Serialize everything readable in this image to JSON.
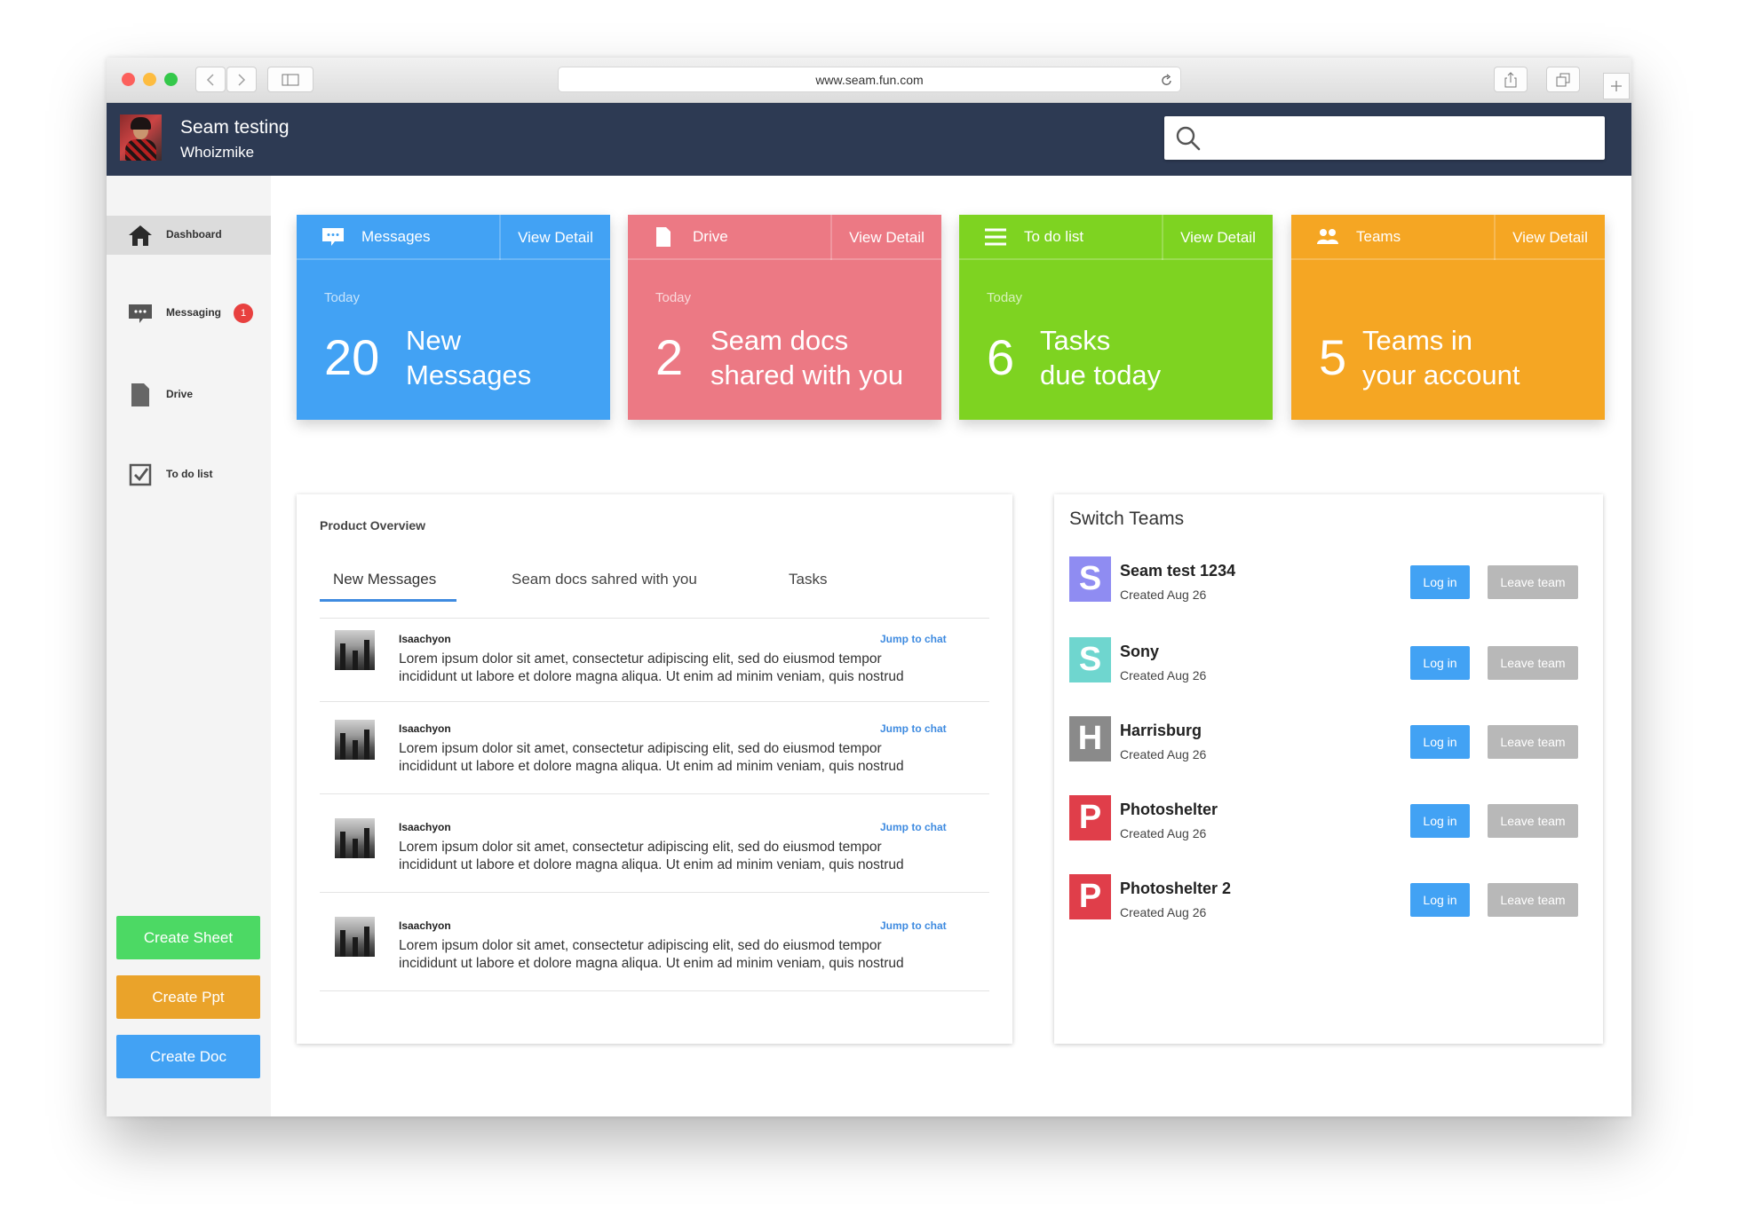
{
  "browser": {
    "url": "www.seam.fun.com"
  },
  "user": {
    "name": "Seam testing",
    "handle": "Whoizmike"
  },
  "search": {
    "placeholder": ""
  },
  "sidebar": {
    "items": [
      {
        "label": "Dashboard",
        "icon": "home-icon"
      },
      {
        "label": "Messaging",
        "icon": "chat-icon",
        "badge": "1"
      },
      {
        "label": "Drive",
        "icon": "document-icon"
      },
      {
        "label": "To do list",
        "icon": "checkbox-icon"
      }
    ],
    "actions": {
      "create_sheet": "Create Sheet",
      "create_ppt": "Create Ppt",
      "create_doc": "Create Doc"
    }
  },
  "cards": [
    {
      "label": "Messages",
      "detail": "View Detail",
      "today": "Today",
      "count": "20",
      "line1": "New",
      "line2": "Messages",
      "color": "#42a2f4"
    },
    {
      "label": "Drive",
      "detail": "View Detail",
      "today": "Today",
      "count": "2",
      "line1": "Seam docs",
      "line2": "shared with you",
      "color": "#ec7984"
    },
    {
      "label": "To do list",
      "detail": "View Detail",
      "today": "Today",
      "count": "6",
      "line1": "Tasks",
      "line2": "due today",
      "color": "#7ed321"
    },
    {
      "label": "Teams",
      "detail": "View Detail",
      "today": "",
      "count": "5",
      "line1": "Teams in",
      "line2": "your account",
      "color": "#f5a623"
    }
  ],
  "overview": {
    "title": "Product Overview",
    "tabs": [
      "New Messages",
      "Seam docs sahred with you",
      "Tasks"
    ],
    "messages": [
      {
        "author": "Isaachyon",
        "jump": "Jump to chat",
        "line1": "Lorem ipsum dolor sit amet, consectetur adipiscing elit, sed do eiusmod tempor",
        "line2": "incididunt ut labore et dolore magna aliqua. Ut enim ad minim veniam, quis nostrud"
      },
      {
        "author": "Isaachyon",
        "jump": "Jump to chat",
        "line1": "Lorem ipsum dolor sit amet, consectetur adipiscing elit, sed do eiusmod tempor",
        "line2": "incididunt ut labore et dolore magna aliqua. Ut enim ad minim veniam, quis nostrud"
      },
      {
        "author": "Isaachyon",
        "jump": "Jump to chat",
        "line1": "Lorem ipsum dolor sit amet, consectetur adipiscing elit, sed do eiusmod tempor",
        "line2": "incididunt ut labore et dolore magna aliqua. Ut enim ad minim veniam, quis nostrud"
      },
      {
        "author": "Isaachyon",
        "jump": "Jump to chat",
        "line1": "Lorem ipsum dolor sit amet, consectetur adipiscing elit, sed do eiusmod tempor",
        "line2": "incididunt ut labore et dolore magna aliqua. Ut enim ad minim veniam, quis nostrud"
      }
    ]
  },
  "teams": {
    "title": "Switch Teams",
    "login_label": "Log in",
    "leave_label": "Leave team",
    "list": [
      {
        "letter": "S",
        "name": "Seam test 1234",
        "created": "Created Aug 26",
        "color": "#8f8cf2"
      },
      {
        "letter": "S",
        "name": "Sony",
        "created": "Created Aug 26",
        "color": "#6fd6cf"
      },
      {
        "letter": "H",
        "name": "Harrisburg",
        "created": "Created Aug 26",
        "color": "#8a8a8a"
      },
      {
        "letter": "P",
        "name": "Photoshelter",
        "created": "Created Aug 26",
        "color": "#e03e4a"
      },
      {
        "letter": "P",
        "name": "Photoshelter 2",
        "created": "Created Aug 26",
        "color": "#e03e4a"
      }
    ]
  }
}
